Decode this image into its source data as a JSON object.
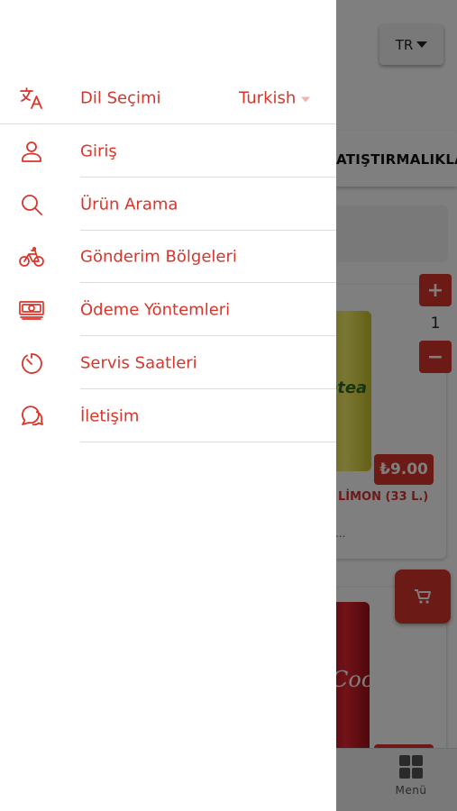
{
  "header": {
    "language_button": "TR"
  },
  "category": {
    "label": "ATIŞTIRMALIKLA"
  },
  "product_1": {
    "name": "LİMON (33 L.)",
    "description": "...",
    "price": "₺9.00",
    "quantity": "1",
    "can_label": "etea"
  },
  "product_2": {
    "can_label": "Coca"
  },
  "quantity_controls": {
    "plus": "+",
    "minus": "−"
  },
  "bottom_nav": {
    "menu_label": "Menü"
  },
  "drawer": {
    "language": {
      "label": "Dil Seçimi",
      "value": "Turkish",
      "icon": "translate-icon"
    },
    "items": [
      {
        "label": "Giriş",
        "icon": "user-icon"
      },
      {
        "label": "Ürün Arama",
        "icon": "search-icon"
      },
      {
        "label": "Gönderim Bölgeleri",
        "icon": "bicycle-icon"
      },
      {
        "label": "Ödeme Yöntemleri",
        "icon": "cash-icon"
      },
      {
        "label": "Servis Saatleri",
        "icon": "timer-icon"
      },
      {
        "label": "İletişim",
        "icon": "chat-icon"
      }
    ]
  },
  "colors": {
    "accent": "#d9352a",
    "overlay": "rgba(0,0,0,0.5)"
  }
}
